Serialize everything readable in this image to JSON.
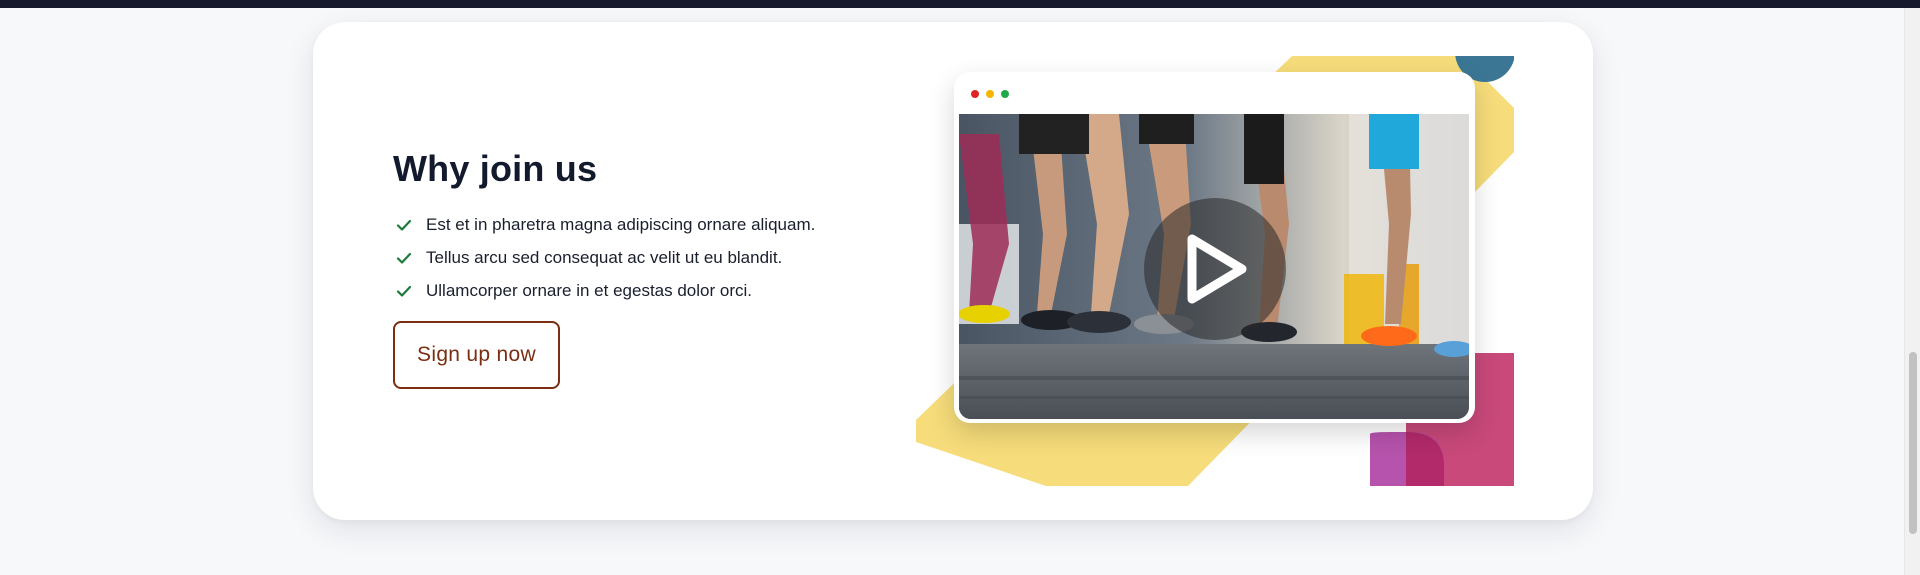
{
  "section": {
    "heading": "Why join us",
    "benefits": [
      {
        "text": "Est et in pharetra magna adipiscing ornare aliquam.",
        "icon": "check-icon"
      },
      {
        "text": "Tellus arcu sed consequat ac velit ut eu blandit.",
        "icon": "check-icon"
      },
      {
        "text": "Ullamcorper ornare in et egestas dolor orci.",
        "icon": "check-icon"
      }
    ],
    "cta_label": "Sign up now"
  },
  "video": {
    "window_controls": [
      "close-dot",
      "minimize-dot",
      "maximize-dot"
    ],
    "play_icon": "play-icon",
    "image_subject": "runners-legs-race-photo"
  },
  "colors": {
    "heading": "#141a2e",
    "check": "#1e7a3c",
    "cta": "#7a2e12",
    "decor_yellow": "#f6dc7a",
    "decor_pink": "#c8497a",
    "decor_blue": "#3b7795",
    "decor_purple": "#b24aa8",
    "dot_red": "#e02424",
    "dot_yellow": "#f4b400",
    "dot_green": "#22a849",
    "top_bar": "#161a2c"
  }
}
